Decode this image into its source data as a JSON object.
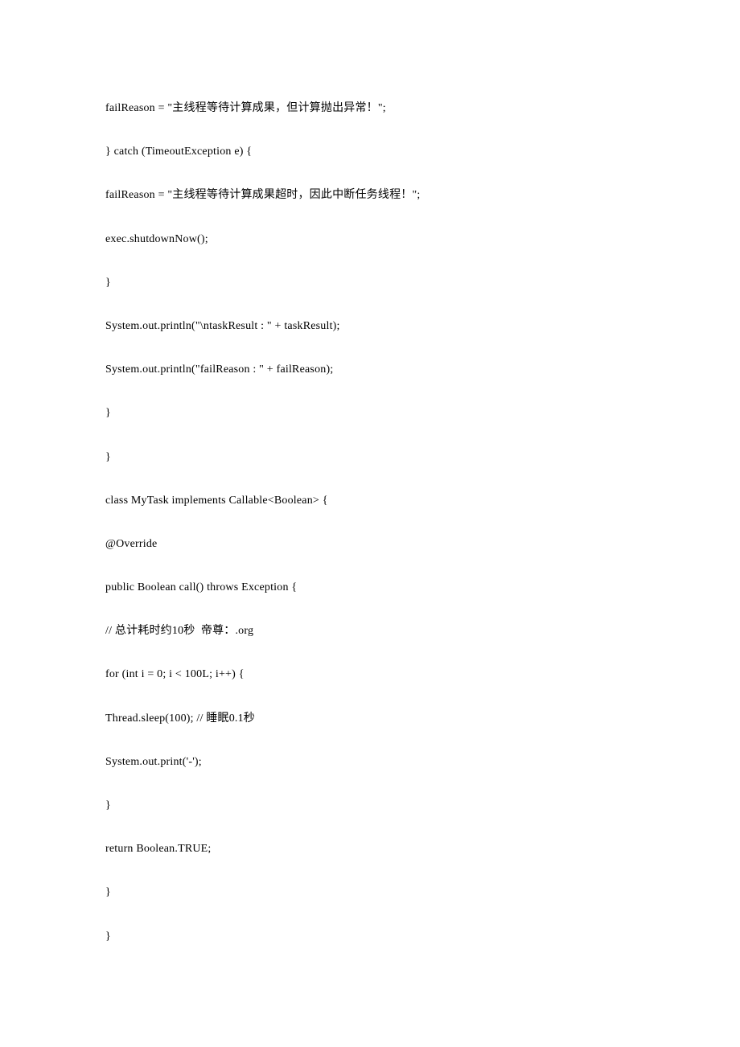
{
  "lines": [
    "failReason = \"主线程等待计算成果，但计算抛出异常！\";",
    "} catch (TimeoutException e) {",
    "failReason = \"主线程等待计算成果超时，因此中断任务线程！\";",
    "exec.shutdownNow();",
    "}",
    "System.out.println(\"\\ntaskResult : \" + taskResult);",
    "System.out.println(\"failReason : \" + failReason);",
    "}",
    "}",
    "class MyTask implements Callable<Boolean> {",
    "@Override",
    "public Boolean call() throws Exception {",
    "// 总计耗时约10秒  帝尊：.org",
    "for (int i = 0; i < 100L; i++) {",
    "Thread.sleep(100); // 睡眠0.1秒",
    "System.out.print('-');",
    "}",
    "return Boolean.TRUE;",
    "}",
    "}"
  ]
}
